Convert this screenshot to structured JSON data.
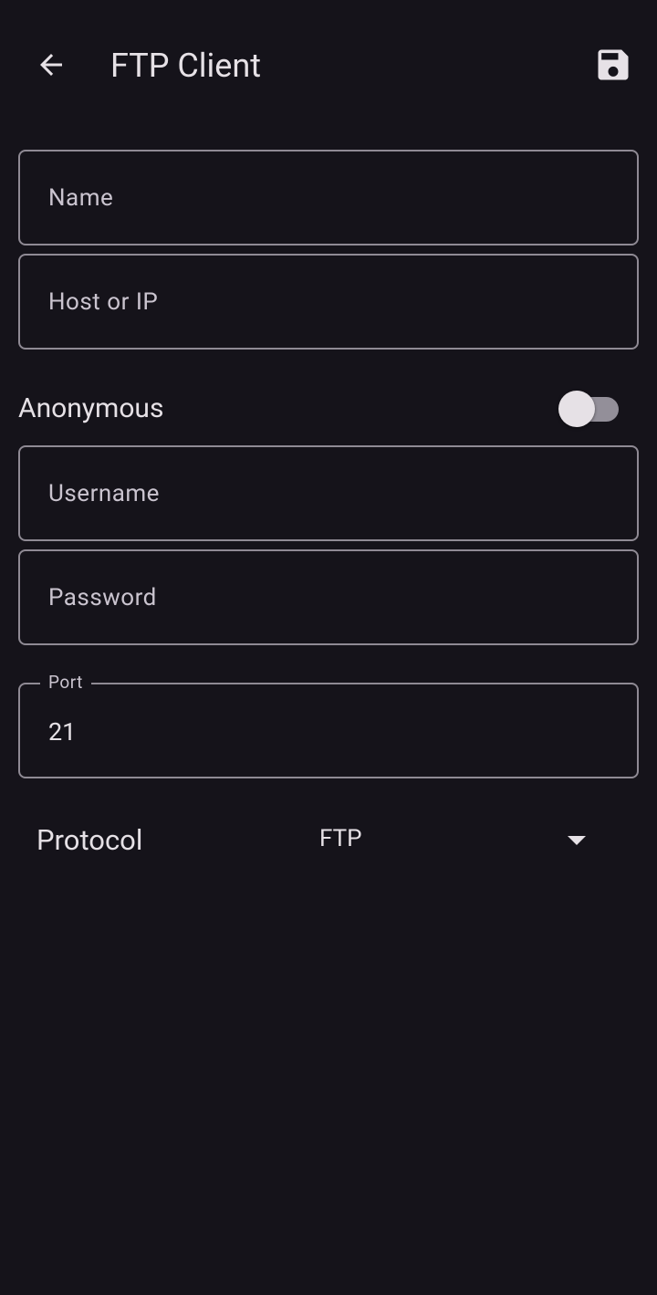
{
  "appbar": {
    "title": "FTP Client",
    "back_icon": "arrow-back-icon",
    "save_icon": "floppy-disk-save-icon"
  },
  "form": {
    "name": {
      "placeholder": "Name",
      "value": ""
    },
    "host": {
      "placeholder": "Host or IP",
      "value": ""
    },
    "anonymous": {
      "label": "Anonymous",
      "enabled": false
    },
    "username": {
      "placeholder": "Username",
      "value": ""
    },
    "password": {
      "placeholder": "Password",
      "value": ""
    },
    "port": {
      "label": "Port",
      "value": "21"
    },
    "protocol": {
      "label": "Protocol",
      "selected": "FTP"
    }
  },
  "colors": {
    "background": "#15131a",
    "text": "#e6e1e6",
    "outline": "#8f8a94",
    "switch_track_off": "#938f99"
  }
}
